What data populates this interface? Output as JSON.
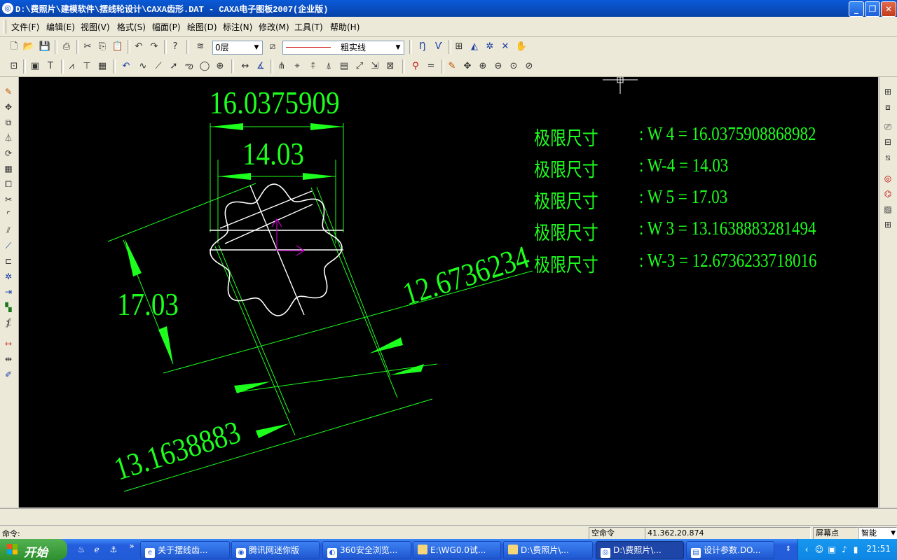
{
  "window": {
    "title": "D:\\费照片\\建模软件\\摆线轮设计\\CAXA齿形.DAT - CAXA电子图板2007(企业版)",
    "buttons": {
      "minimize": "_",
      "restore": "❐",
      "close": "✕"
    }
  },
  "menu": [
    "文件(F)",
    "编辑(E)",
    "视图(V)",
    "格式(S)",
    "幅面(P)",
    "绘图(D)",
    "标注(N)",
    "修改(M)",
    "工具(T)",
    "帮助(H)"
  ],
  "toolbar": {
    "layer_value": "0层",
    "linestyle_value": "粗实线",
    "cursor_readout": ""
  },
  "drawing": {
    "dims": {
      "top_outer": "16.0375909",
      "top_inner": "14.03",
      "left": "17.03",
      "right": "12.6736234",
      "bottom": "13.1638883"
    },
    "limits": [
      {
        "label": "极限尺寸",
        "value": ": W 4 = 16.0375908868982"
      },
      {
        "label": "极限尺寸",
        "value": ": W-4 = 14.03"
      },
      {
        "label": "极限尺寸",
        "value": ": W 5 = 17.03"
      },
      {
        "label": "极限尺寸",
        "value": ": W 3 = 13.1638883281494"
      },
      {
        "label": "极限尺寸",
        "value": ": W-3 = 12.6736233718016"
      }
    ],
    "colors": {
      "background": "#000000",
      "dimension": "#1dff1d",
      "geometry": "#ffffff",
      "axis": "#c000c0"
    }
  },
  "command": {
    "prompt": "命令:"
  },
  "status": {
    "mode": "空命令",
    "coords": "41.362,20.874",
    "snap_label": "屏幕点",
    "snap_mode": "智能"
  },
  "taskbar": {
    "start_label": "开始",
    "more": "»",
    "tasks": [
      {
        "label": "关于摆线齿...",
        "icon": "ie-icon"
      },
      {
        "label": "腾讯网迷你版",
        "icon": "qq-browser-icon"
      },
      {
        "label": "360安全浏览...",
        "icon": "360-browser-icon"
      },
      {
        "label": "E:\\WG0.0试...",
        "icon": "folder-icon"
      },
      {
        "label": "D:\\费照片\\...",
        "icon": "folder-icon"
      },
      {
        "label": "D:\\费照片\\...",
        "icon": "caxa-icon"
      },
      {
        "label": "设计参数.DO...",
        "icon": "doc-icon"
      }
    ],
    "clock": "21:51"
  }
}
